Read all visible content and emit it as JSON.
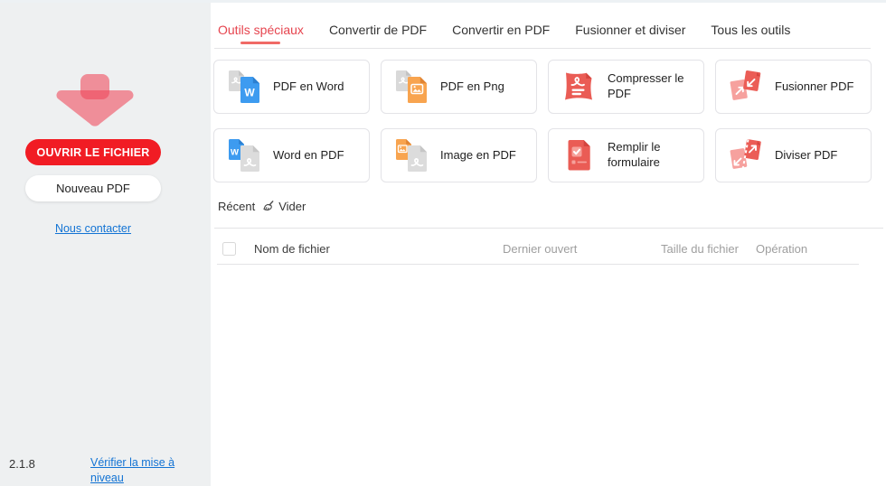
{
  "sidebar": {
    "open_file_button": "OUVRIR LE FICHIER",
    "new_pdf_button": "Nouveau PDF",
    "contact_link": "Nous contacter",
    "version": "2.1.8",
    "upgrade_link": "Vérifier la mise à niveau"
  },
  "tabs": [
    {
      "label": "Outils spéciaux",
      "active": true
    },
    {
      "label": "Convertir de PDF",
      "active": false
    },
    {
      "label": "Convertir en PDF",
      "active": false
    },
    {
      "label": "Fusionner et diviser",
      "active": false
    },
    {
      "label": "Tous les outils",
      "active": false
    }
  ],
  "tools": [
    {
      "label": "PDF en Word",
      "icon": "pdf-to-word-icon"
    },
    {
      "label": "PDF en Png",
      "icon": "pdf-to-png-icon"
    },
    {
      "label": "Compresser le PDF",
      "icon": "compress-pdf-icon"
    },
    {
      "label": "Fusionner PDF",
      "icon": "merge-pdf-icon"
    },
    {
      "label": "Word en PDF",
      "icon": "word-to-pdf-icon"
    },
    {
      "label": "Image en PDF",
      "icon": "image-to-pdf-icon"
    },
    {
      "label": "Remplir le formulaire",
      "icon": "fill-form-icon"
    },
    {
      "label": "Diviser PDF",
      "icon": "split-pdf-icon"
    }
  ],
  "recent": {
    "title": "Récent",
    "clear_label": "Vider",
    "clear_icon": "broom-icon"
  },
  "table": {
    "headers": {
      "name": "Nom de fichier",
      "last_opened": "Dernier ouvert",
      "file_size": "Taille du fichier",
      "operation": "Opération"
    }
  },
  "colors": {
    "accent_red": "#f11c24",
    "active_tab_red": "#e6444e",
    "icon_red": "#ea5c55",
    "icon_pink": "#f6a19e",
    "icon_blue": "#3d9bf0",
    "icon_orange": "#f8a44f",
    "link_blue": "#1273d4",
    "sidebar_bg": "#eef0f1"
  }
}
